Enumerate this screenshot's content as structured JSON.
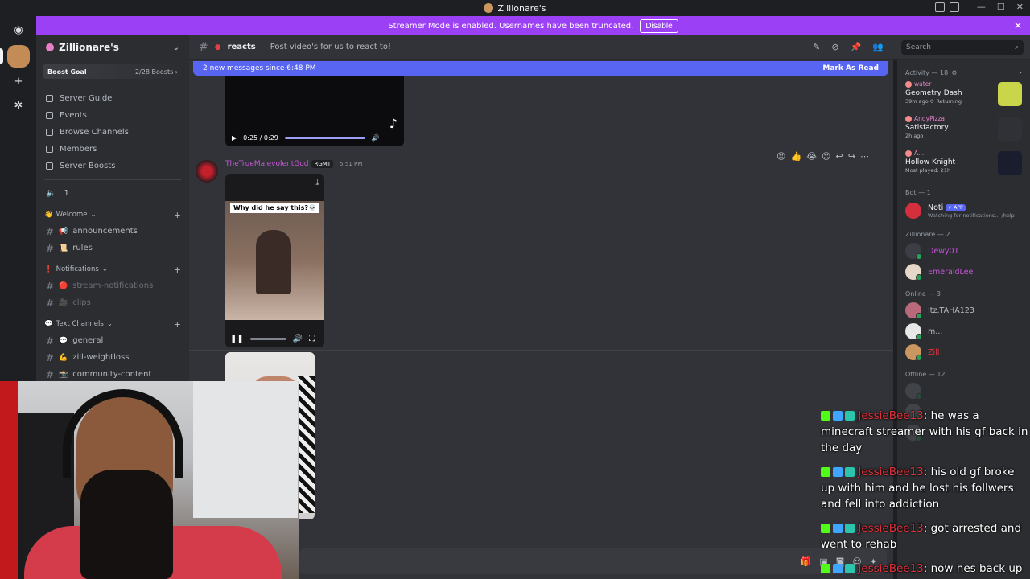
{
  "window": {
    "title": "Zillionare's"
  },
  "banner": {
    "text": "Streamer Mode is enabled. Usernames have been truncated.",
    "disable_label": "Disable"
  },
  "guild": {
    "name": "Zillionare's",
    "boost_goal_label": "Boost Goal",
    "boost_count": "2/28 Boosts ›"
  },
  "sidebar": {
    "nav": [
      {
        "label": "Server Guide",
        "icon": "compass-icon"
      },
      {
        "label": "Events",
        "icon": "calendar-icon"
      },
      {
        "label": "Browse Channels",
        "icon": "list-icon"
      },
      {
        "label": "Members",
        "icon": "members-icon"
      },
      {
        "label": "Server Boosts",
        "icon": "boost-icon"
      }
    ],
    "voice_label": "1",
    "categories": [
      {
        "label": "Welcome",
        "emoji": "👋",
        "channels": [
          {
            "label": "announcements",
            "emoji": "📢",
            "emoji_color": "#e0404a"
          },
          {
            "label": "rules",
            "emoji": "📜",
            "emoji_color": "#d8b46b"
          }
        ]
      },
      {
        "label": "Notifications",
        "emoji": "❗",
        "channels": [
          {
            "label": "stream-notifications",
            "emoji": "🔴",
            "emoji_color": "#e03030"
          },
          {
            "label": "clips",
            "emoji": "🎥",
            "emoji_color": "#8b8fe0"
          }
        ]
      },
      {
        "label": "Text Channels",
        "emoji": "💬",
        "channels": [
          {
            "label": "general",
            "emoji": "💬",
            "emoji_color": "#ffffff"
          },
          {
            "label": "zill-weightloss",
            "emoji": "💪",
            "emoji_color": "#f2c84b"
          },
          {
            "label": "community-content",
            "emoji": "📸",
            "emoji_color": "#e0404a"
          }
        ]
      }
    ]
  },
  "channel": {
    "name": "reacts",
    "topic": "Post video's for us to react to!"
  },
  "search": {
    "placeholder": "Search"
  },
  "messages": {
    "new_bar_text": "2 new messages since 6:48 PM",
    "mark_read": "Mark As Read",
    "video1_time": "0:25 / 0:29",
    "author": "TheTrueMalevolentGod",
    "author_tag": "RGMT",
    "timestamp": "5:51 PM",
    "video2_caption": "Why did he say this?💀"
  },
  "members": {
    "activity_header": "Activity — 18",
    "activities": [
      {
        "user": "water",
        "game": "Geometry Dash",
        "meta": "39m ago  ⟳ Returning",
        "icon_color": "#c9d64a"
      },
      {
        "user": "AndyPizza",
        "game": "Satisfactory",
        "meta": "2h ago",
        "icon_color": "#2f3136"
      },
      {
        "user": "A...",
        "game": "Hollow Knight",
        "meta": "Most played: 21h",
        "icon_color": "#1a1d2e"
      }
    ],
    "bot_header": "Bot — 1",
    "bot": {
      "name": "Noti",
      "tag": "✓ APP",
      "status": "Watching for notifications... /help",
      "color": "#d32f3c"
    },
    "role_header": "Zillionare — 2",
    "role_members": [
      {
        "name": "Dewy01",
        "color": "#c856d9",
        "avatar": "#3b3f45"
      },
      {
        "name": "EmeraldLee",
        "color": "#c856d9",
        "avatar": "#e6d8c8"
      }
    ],
    "online_header": "Online — 3",
    "online_members": [
      {
        "name": "Itz.TAHA123",
        "color": "#b5bac1",
        "avatar": "#b86a7a"
      },
      {
        "name": "m...",
        "color": "#b5bac1",
        "avatar": "#e8e8e8"
      },
      {
        "name": "Zill",
        "color": "#e0323c",
        "avatar": "#c9975f"
      }
    ],
    "offline_header": "Offline — 12"
  },
  "chat": [
    {
      "nick": "JessieBee13",
      "text": "he was a minecraft streamer with his gf back in the day"
    },
    {
      "nick": "JessieBee13",
      "text": "his old gf broke up with him and he lost his follwers and fell into addiction"
    },
    {
      "nick": "JessieBee13",
      "text": "got arrested and went to rehab"
    },
    {
      "nick": "JessieBee13",
      "text": "now hes back up"
    }
  ]
}
